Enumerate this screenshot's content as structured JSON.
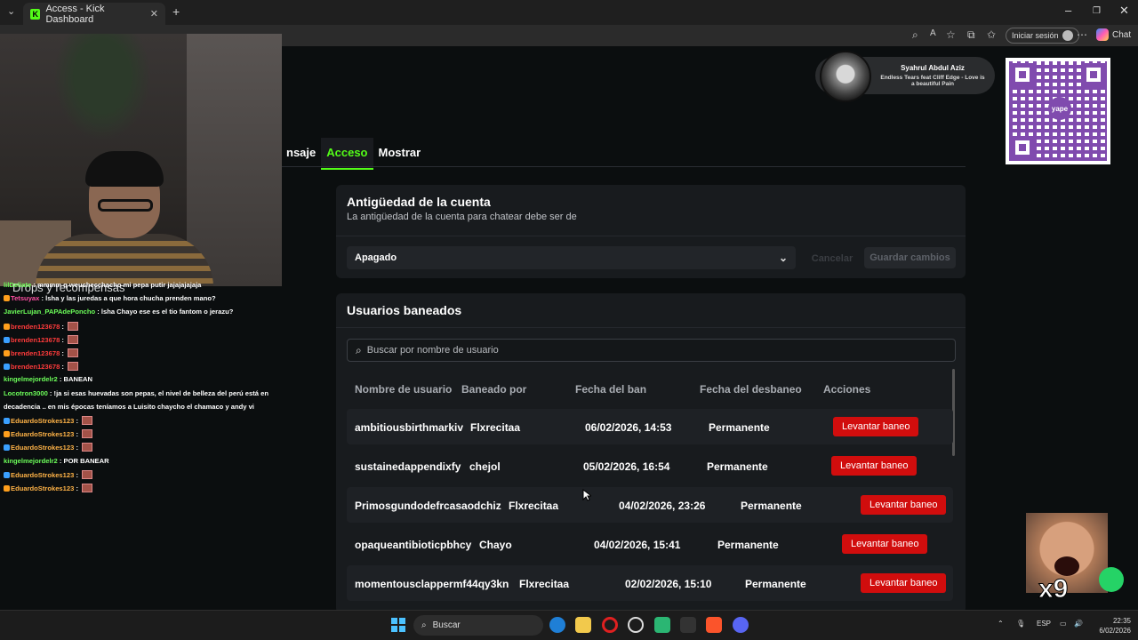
{
  "browser": {
    "tab_title": "Access - Kick Dashboard",
    "favicon_letter": "K",
    "signin_label": "Iniciar sesión",
    "chat_label": "Chat"
  },
  "page": {
    "tabs": [
      {
        "label": "nsaje",
        "active": false
      },
      {
        "label": "Acceso",
        "active": true
      },
      {
        "label": "Mostrar",
        "active": false
      }
    ],
    "account_age": {
      "title": "Antigüedad de la cuenta",
      "subtitle": "La antigüedad de la cuenta para chatear debe ser de",
      "select_value": "Apagado",
      "cancel_label": "Cancelar",
      "save_label": "Guardar cambios"
    },
    "banned": {
      "title": "Usuarios baneados",
      "search_placeholder": "Buscar por nombre de usuario",
      "columns": [
        "Nombre de usuario",
        "Baneado por",
        "Fecha del ban",
        "Fecha del desbaneo",
        "Acciones"
      ],
      "rows": [
        {
          "user": "ambitiousbirthmarkiv",
          "by": "Flxrecitaa",
          "date": "06/02/2026, 14:53",
          "unban_date": "Permanente",
          "action": "Levantar baneo"
        },
        {
          "user": "sustainedappendixfy",
          "by": "chejol",
          "date": "05/02/2026, 16:54",
          "unban_date": "Permanente",
          "action": "Levantar baneo"
        },
        {
          "user": "Primosgundodefrcasaodchiz",
          "by": "Flxrecitaa",
          "date": "04/02/2026, 23:26",
          "unban_date": "Permanente",
          "action": "Levantar baneo"
        },
        {
          "user": "opaqueantibioticpbhcy",
          "by": "Chayo",
          "date": "04/02/2026, 15:41",
          "unban_date": "Permanente",
          "action": "Levantar baneo"
        },
        {
          "user": "momentousclappermf44qy3kn",
          "by": "Flxrecitaa",
          "date": "02/02/2026, 15:10",
          "unban_date": "Permanente",
          "action": "Levantar baneo"
        }
      ]
    }
  },
  "now_playing": {
    "artist": "Syahrul Abdul Aziz",
    "track": "Endless Tears feat Cliff Edge - Love is a beautiful Pain"
  },
  "qr_label": "yape",
  "chat_overlay": {
    "header_fragment": "Drops y recompensas",
    "lines": [
      {
        "user": "lilDeliate",
        "color": "green",
        "msg": "mmmm q weuchecchacho mi pepa putir jajajajajaja"
      },
      {
        "user": "Tetsuyax",
        "color": "pink",
        "msg": "lsha y las juredas a que hora chucha prenden mano?"
      },
      {
        "user": "JavierLujan_PAPAdePoncho",
        "color": "green",
        "msg": "lsha Chayo ese es el tio fantom o jerazu?"
      },
      {
        "user": "brenden123678",
        "color": "red",
        "msg": ""
      },
      {
        "user": "brenden123678",
        "color": "red",
        "msg": ""
      },
      {
        "user": "brenden123678",
        "color": "red",
        "msg": ""
      },
      {
        "user": "brenden123678",
        "color": "red",
        "msg": ""
      },
      {
        "user": "kingelmejordelr2",
        "color": "green",
        "msg": "BANEAN"
      },
      {
        "user": "Locotron3000",
        "color": "green",
        "msg": "!ja si esas huevadas son pepas, el nivel de belleza del perú está en"
      },
      {
        "user": "",
        "color": "white",
        "msg": "decadencia .. en mis épocas teníamos a Luisito chaycho el chamaco y andy vi"
      },
      {
        "user": "EduardoStrokes123",
        "color": "orange",
        "msg": ""
      },
      {
        "user": "EduardoStrokes123",
        "color": "orange",
        "msg": ""
      },
      {
        "user": "EduardoStrokes123",
        "color": "orange",
        "msg": ""
      },
      {
        "user": "kingelmejordelr2",
        "color": "green",
        "msg": "POR BANEAR"
      },
      {
        "user": "EduardoStrokes123",
        "color": "orange",
        "msg": ""
      },
      {
        "user": "EduardoStrokes123",
        "color": "orange",
        "msg": ""
      }
    ]
  },
  "meme_caption": "x9",
  "taskbar": {
    "search_label": "Buscar",
    "lang": "ESP",
    "time": "22:35",
    "date": "6/02/2026"
  },
  "colors": {
    "accent": "#53fc18",
    "danger": "#d10d0d",
    "card": "#181b1e"
  }
}
